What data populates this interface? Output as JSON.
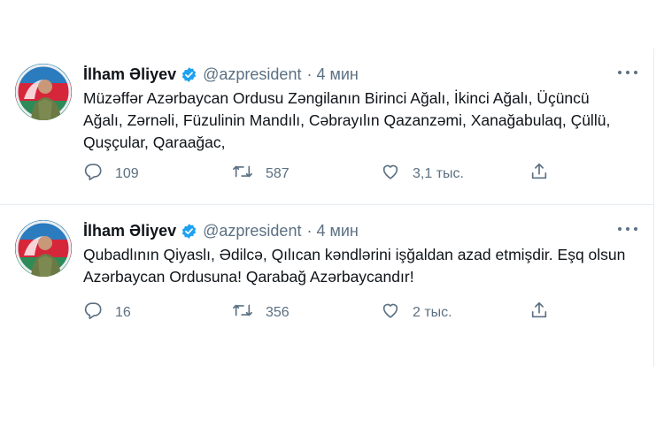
{
  "tweets": [
    {
      "author": "İlham Əliyev",
      "handle": "@azpresident",
      "separator": "·",
      "time": "4 мин",
      "text": "Müzəffər Azərbaycan Ordusu Zəngilanın Birinci Ağalı, İkinci Ağalı, Üçüncü Ağalı, Zərnəli, Füzulinin Mandılı, Cəbrayılın Qazanzəmi, Xanağabulaq, Çüllü, Quşçular, Qaraağac,",
      "replies": "109",
      "retweets": "587",
      "likes": "3,1 тыс."
    },
    {
      "author": "İlham Əliyev",
      "handle": "@azpresident",
      "separator": "·",
      "time": "4 мин",
      "text": "Qubadlının Qiyaslı, Ədilcə, Qılıcan kəndlərini işğaldan azad etmişdir. Eşq olsun Azərbaycan Ordusuna! Qarabağ Azərbaycandır!",
      "replies": "16",
      "retweets": "356",
      "likes": "2 тыс."
    }
  ],
  "icons": {
    "verified": "verified-badge-icon",
    "reply": "reply-icon",
    "retweet": "retweet-icon",
    "like": "heart-icon",
    "share": "share-icon",
    "more": "more-icon"
  },
  "colors": {
    "verified": "#1da1f2",
    "muted": "#5b7083",
    "text": "#0f1419",
    "divider": "#e6ecf0"
  }
}
